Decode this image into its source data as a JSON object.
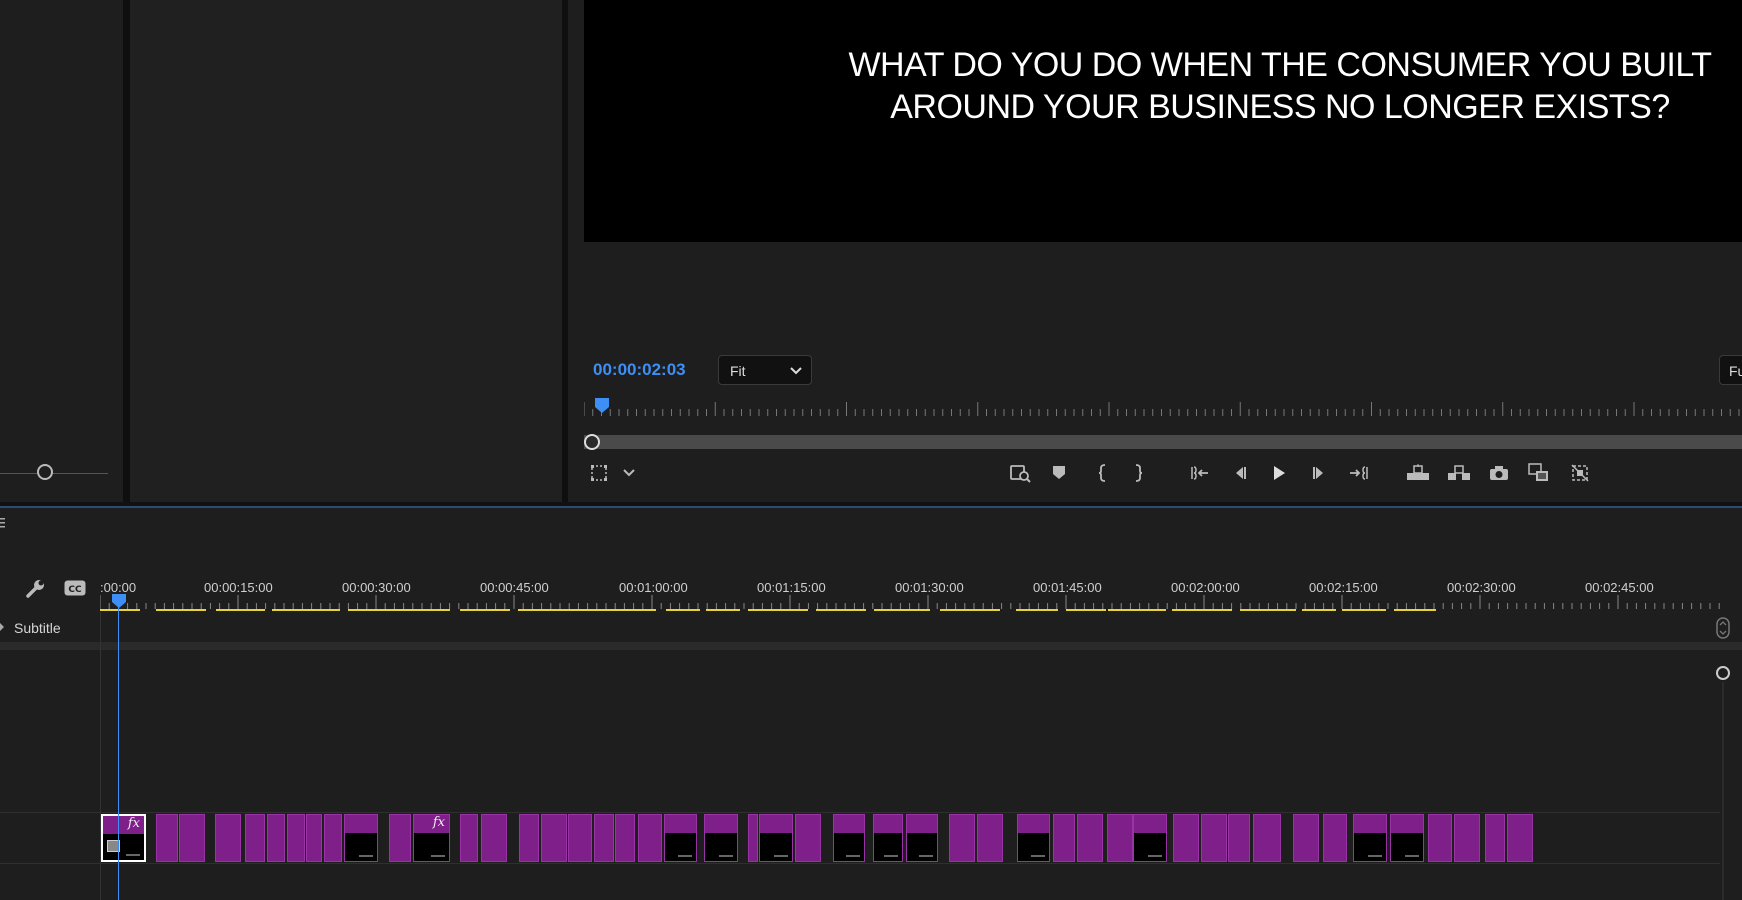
{
  "program_monitor": {
    "caption_line_1": "WHAT DO YOU DO WHEN THE CONSUMER YOU BUILT",
    "caption_line_2": "AROUND YOUR BUSINESS NO LONGER EXISTS?",
    "timecode": "00:00:02:03",
    "fit_option": "Fit",
    "resolution_option": "Fu"
  },
  "timeline": {
    "ruler_labels": [
      ":00:00",
      "00:00:15:00",
      "00:00:30:00",
      "00:00:45:00",
      "00:01:00:00",
      "00:01:15:00",
      "00:01:30:00",
      "00:01:45:00",
      "00:02:00:00",
      "00:02:15:00",
      "00:02:30:00",
      "00:02:45:00"
    ],
    "subtitle_track_label": "Subtitle"
  },
  "icons": {
    "wrench": "wrench-icon",
    "captions": "cc-icon",
    "export_frame": "camera-icon",
    "play": "play-icon"
  },
  "colors": {
    "accent": "#3d8ff5",
    "clip": "#7e1f8a",
    "render_bar": "#e6d43a"
  }
}
